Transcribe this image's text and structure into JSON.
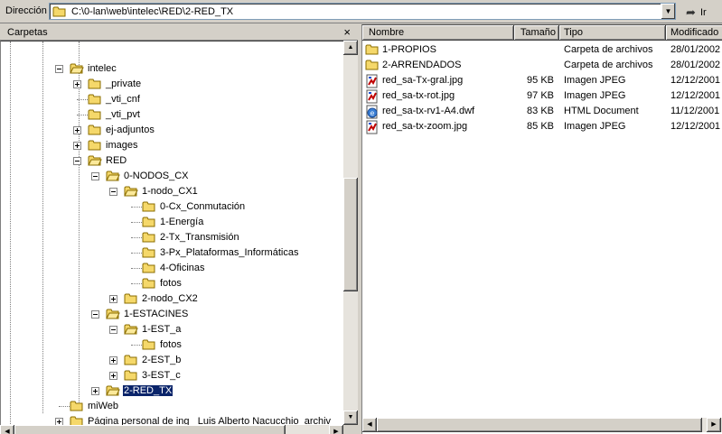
{
  "address": {
    "label": "Dirección",
    "path": "C:\\0-lan\\web\\intelec\\RED\\2-RED_TX",
    "go_label": "Ir"
  },
  "folders_pane": {
    "title": "Carpetas",
    "close_glyph": "×"
  },
  "tree": [
    {
      "label": "intelec",
      "expander": "minus",
      "open": true
    },
    {
      "label": "_private",
      "expander": "plus",
      "open": false
    },
    {
      "label": "_vti_cnf",
      "expander": "none",
      "open": false
    },
    {
      "label": "_vti_pvt",
      "expander": "none",
      "open": false
    },
    {
      "label": "ej-adjuntos",
      "expander": "plus",
      "open": false
    },
    {
      "label": "images",
      "expander": "plus",
      "open": false
    },
    {
      "label": "RED",
      "expander": "minus",
      "open": true
    },
    {
      "label": "0-NODOS_CX",
      "expander": "minus",
      "open": true
    },
    {
      "label": "1-nodo_CX1",
      "expander": "minus",
      "open": true
    },
    {
      "label": "0-Cx_Conmutación",
      "expander": "none",
      "open": false
    },
    {
      "label": "1-Energía",
      "expander": "none",
      "open": false
    },
    {
      "label": "2-Tx_Transmisión",
      "expander": "none",
      "open": false
    },
    {
      "label": "3-Px_Plataformas_Informáticas",
      "expander": "none",
      "open": false
    },
    {
      "label": "4-Oficinas",
      "expander": "none",
      "open": false
    },
    {
      "label": "fotos",
      "expander": "none",
      "open": false
    },
    {
      "label": "2-nodo_CX2",
      "expander": "plus",
      "open": false
    },
    {
      "label": "1-ESTACINES",
      "expander": "minus",
      "open": true
    },
    {
      "label": "1-EST_a",
      "expander": "minus",
      "open": true
    },
    {
      "label": "fotos",
      "expander": "none",
      "open": false
    },
    {
      "label": "2-EST_b",
      "expander": "plus",
      "open": false
    },
    {
      "label": "3-EST_c",
      "expander": "plus",
      "open": false
    },
    {
      "label": "2-RED_TX",
      "expander": "plus",
      "open": true,
      "selected": true
    },
    {
      "label": "miWeb",
      "expander": "none",
      "open": false
    },
    {
      "label": "Página personal de ing_ Luis Alberto Nacucchio_archiv",
      "expander": "plus",
      "open": false
    }
  ],
  "columns": {
    "name": "Nombre",
    "size": "Tamaño",
    "type": "Tipo",
    "modified": "Modificado"
  },
  "files": [
    {
      "name": "1-PROPIOS",
      "size": "",
      "type": "Carpeta de archivos",
      "modified": "28/01/2002",
      "icon": "folder-icon"
    },
    {
      "name": "2-ARRENDADOS",
      "size": "",
      "type": "Carpeta de archivos",
      "modified": "28/01/2002",
      "icon": "folder-icon"
    },
    {
      "name": "red_sa-Tx-gral.jpg",
      "size": "95 KB",
      "type": "Imagen JPEG",
      "modified": "12/12/2001",
      "icon": "jpeg-file-icon"
    },
    {
      "name": "red_sa-tx-rot.jpg",
      "size": "97 KB",
      "type": "Imagen JPEG",
      "modified": "12/12/2001",
      "icon": "jpeg-file-icon"
    },
    {
      "name": "red_sa-tx-rv1-A4.dwf",
      "size": "83 KB",
      "type": "HTML Document",
      "modified": "11/12/2001",
      "icon": "html-document-icon"
    },
    {
      "name": "red_sa-tx-zoom.jpg",
      "size": "85 KB",
      "type": "Imagen JPEG",
      "modified": "12/12/2001",
      "icon": "jpeg-file-icon"
    }
  ],
  "colors": {
    "chrome": "#d4d0c8",
    "folder": "#f5d86a",
    "selection": "#0a246a"
  }
}
